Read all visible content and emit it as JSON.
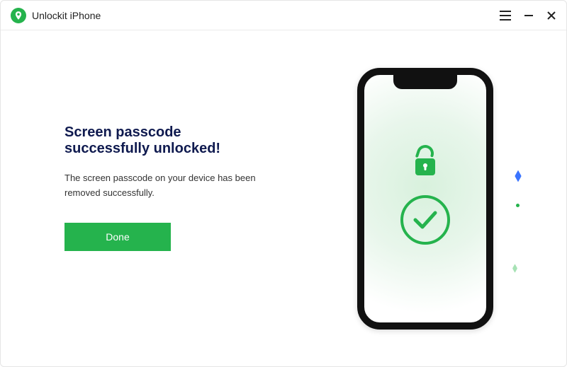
{
  "titlebar": {
    "app_name": "Unlockit iPhone"
  },
  "main": {
    "heading": "Screen passcode successfully unlocked!",
    "subtext": "The screen passcode on your device has been removed successfully.",
    "done_label": "Done"
  },
  "colors": {
    "accent": "#25b34d",
    "heading": "#0f1a4f"
  }
}
